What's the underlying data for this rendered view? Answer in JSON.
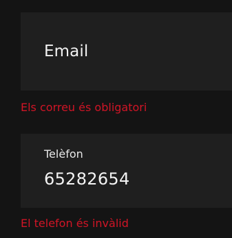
{
  "form": {
    "email": {
      "label": "Email",
      "value": "",
      "error": "Els correu és obligatori"
    },
    "phone": {
      "label": "Telèfon",
      "value": "65282654",
      "error": "El telefon és invàlid"
    }
  },
  "colors": {
    "background": "#141414",
    "field_background": "#1f1f1f",
    "text": "#f2f2f2",
    "error": "#d11526"
  }
}
